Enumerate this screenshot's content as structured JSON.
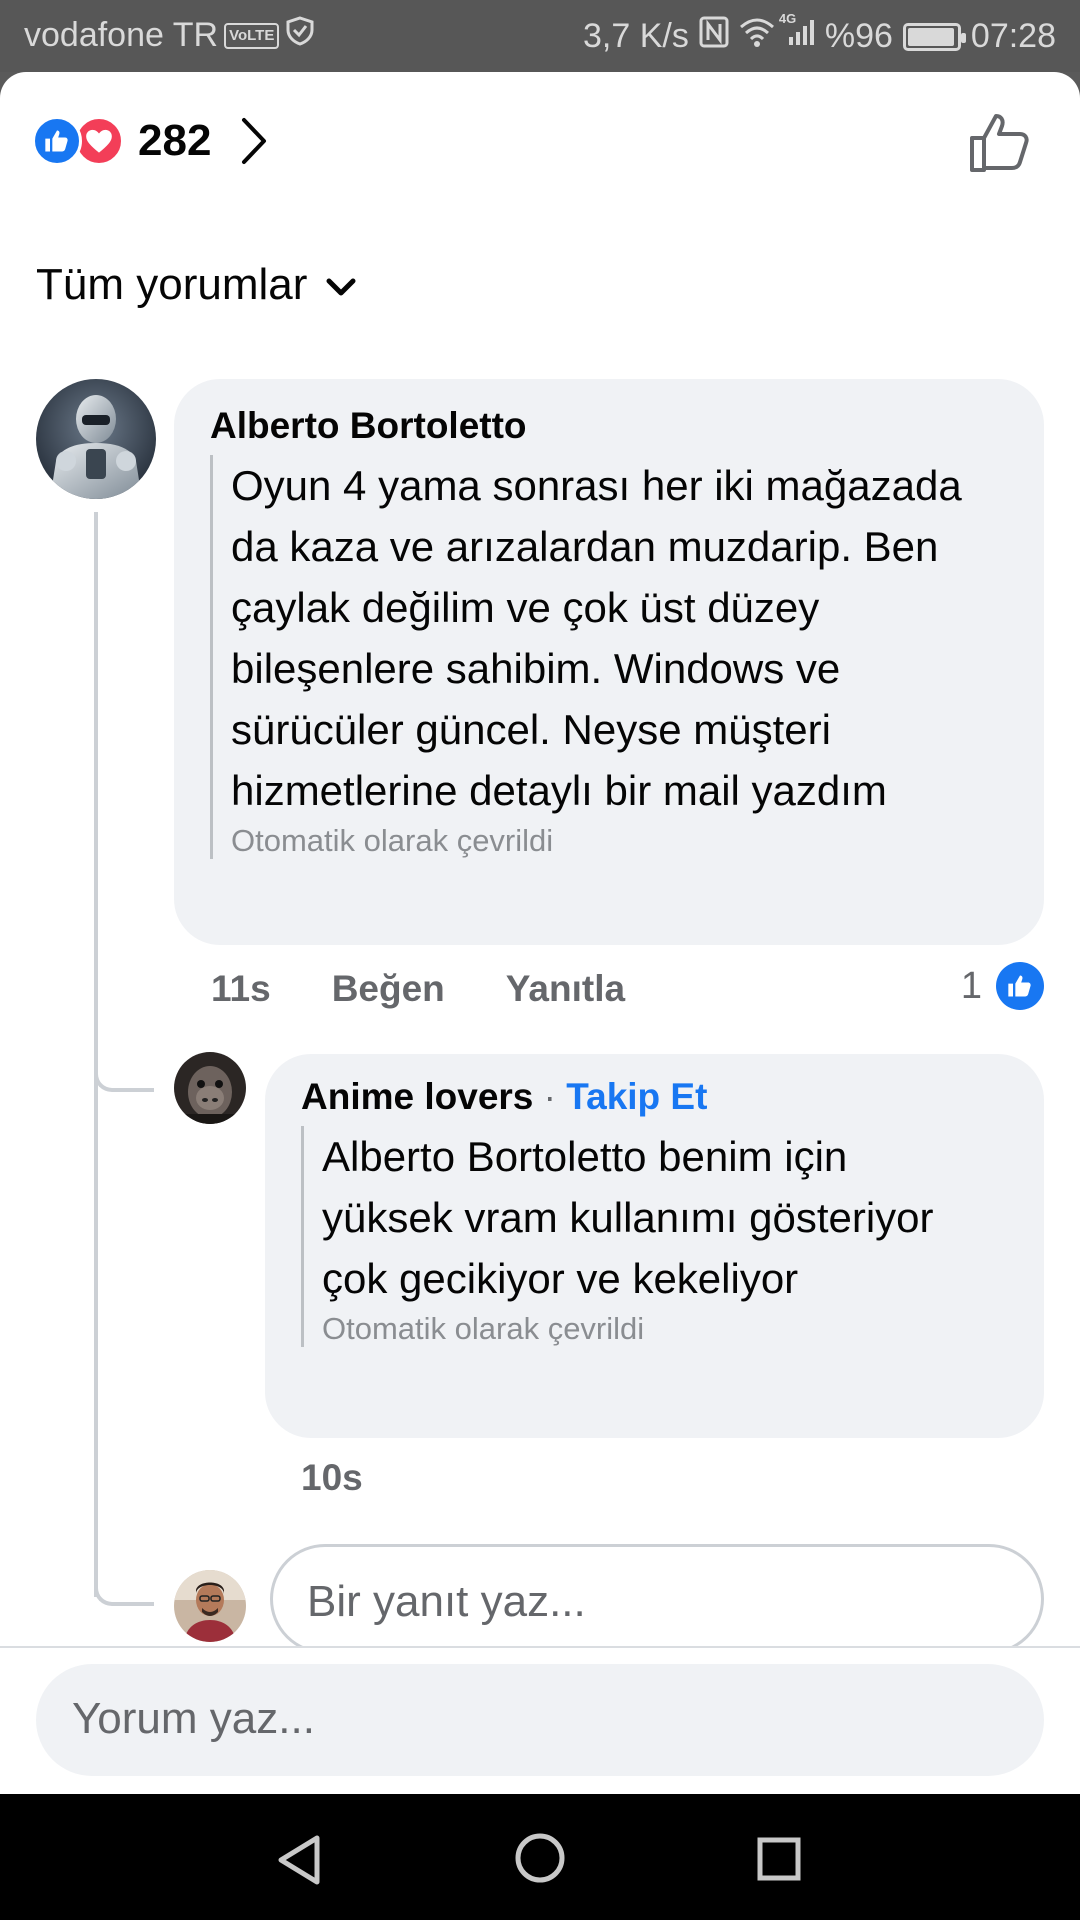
{
  "status_bar": {
    "carrier": "vodafone TR",
    "volte": "VoLTE",
    "speed": "3,7 K/s",
    "network_type": "4G",
    "battery_text": "%96",
    "battery_level": 0.96,
    "time": "07:28"
  },
  "reactions": {
    "count": "282",
    "icons": [
      "like-icon",
      "love-icon"
    ]
  },
  "filter": {
    "label": "Tüm yorumlar"
  },
  "comments": [
    {
      "author": "Alberto Bortoletto",
      "text": "Oyun 4 yama sonrası her iki mağazada da kaza ve arızalardan muzdarip. Ben çaylak değilim ve çok üst düzey bileşenlere sahibim. Windows ve sürücüler güncel. Neyse müşteri hizmetlerine detaylı bir mail yazdım",
      "translated": "Otomatik olarak çevrildi",
      "time": "11s",
      "like_label": "Beğen",
      "reply_label": "Yanıtla",
      "like_count": "1"
    }
  ],
  "replies": [
    {
      "author": "Anime lovers",
      "separator": "·",
      "follow_label": "Takip Et",
      "text": "Alberto Bortoletto benim için yüksek vram kullanımı gösteriyor çok gecikiyor ve kekeliyor",
      "translated": "Otomatik olarak çevrildi",
      "time": "10s"
    }
  ],
  "reply_input": {
    "placeholder": "Bir yanıt yaz..."
  },
  "comment_input": {
    "placeholder": "Yorum yaz..."
  },
  "colors": {
    "accent": "#1877f2",
    "love": "#f33e58",
    "bubble": "#f0f2f5",
    "secondary_text": "#65676b"
  }
}
